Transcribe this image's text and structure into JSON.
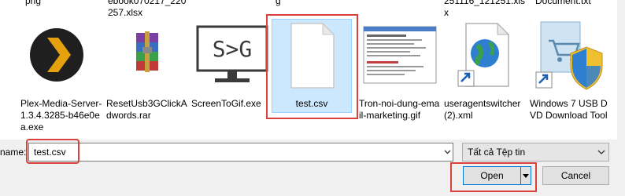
{
  "top_partials": [
    "png",
    "ebook070217_220 257.xlsx",
    "g",
    "251116_121251.xls x",
    "Document.txt"
  ],
  "files": [
    {
      "name": "Plex-Media-Server-1.3.4.3285-b46e0ea.exe",
      "icon": "plex-icon"
    },
    {
      "name": "ResetUsb3GClickAdwords.rar",
      "icon": "winrar-archive-icon"
    },
    {
      "name": "ScreenToGif.exe",
      "icon": "screentogif-icon"
    },
    {
      "name": "test.csv",
      "icon": "blank-document-icon"
    },
    {
      "name": "Tron-noi-dung-email-marketing.gif",
      "icon": "image-thumbnail-icon"
    },
    {
      "name": "useragentswitcher (2).xml",
      "icon": "xml-globe-icon"
    },
    {
      "name": "Windows 7 USB DVD Download Tool",
      "icon": "windows-shield-icon"
    }
  ],
  "footer": {
    "name_label": "name:",
    "name_value": "test.csv",
    "file_type": "Tất cả Tệp tin",
    "open_label": "Open",
    "cancel_label": "Cancel"
  },
  "colors": {
    "selection": "#cce8ff",
    "highlight": "#d9413b",
    "accent": "#0078d7"
  }
}
